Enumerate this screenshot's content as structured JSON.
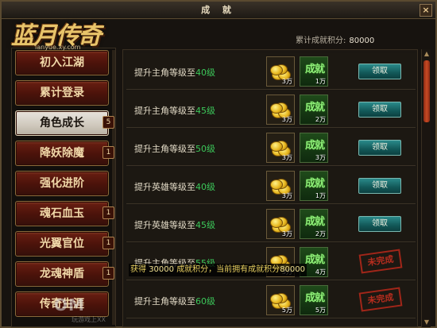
{
  "window": {
    "title": "成 就",
    "close_label": "×"
  },
  "logo": {
    "title": "蓝月传奇",
    "site": "lanyue.xy.com"
  },
  "header": {
    "total_label": "累计成就积分:",
    "total_value": "80000"
  },
  "sidebar": {
    "items": [
      {
        "label": "初入江湖",
        "badge": null,
        "active": false
      },
      {
        "label": "累计登录",
        "badge": null,
        "active": false
      },
      {
        "label": "角色成长",
        "badge": "5",
        "active": true
      },
      {
        "label": "降妖除魔",
        "badge": "1",
        "active": false
      },
      {
        "label": "强化进阶",
        "badge": null,
        "active": false
      },
      {
        "label": "魂石血玉",
        "badge": "1",
        "active": false
      },
      {
        "label": "光翼官位",
        "badge": "1",
        "active": false
      },
      {
        "label": "龙魂神盾",
        "badge": "1",
        "active": false
      },
      {
        "label": "传奇生涯",
        "badge": null,
        "active": false
      }
    ]
  },
  "achievements": [
    {
      "prefix": "提升主角等级至",
      "level": "40级",
      "gold": "3万",
      "points": "1万",
      "status": "claim"
    },
    {
      "prefix": "提升主角等级至",
      "level": "45级",
      "gold": "3万",
      "points": "2万",
      "status": "claim"
    },
    {
      "prefix": "提升主角等级至",
      "level": "50级",
      "gold": "3万",
      "points": "3万",
      "status": "claim"
    },
    {
      "prefix": "提升英雄等级至",
      "level": "40级",
      "gold": "3万",
      "points": "1万",
      "status": "claim"
    },
    {
      "prefix": "提升英雄等级至",
      "level": "45级",
      "gold": "3万",
      "points": "2万",
      "status": "claim"
    },
    {
      "prefix": "提升主角等级至",
      "level": "55级",
      "gold": "3万",
      "points": "4万",
      "status": "incomplete"
    },
    {
      "prefix": "提升主角等级至",
      "level": "60级",
      "gold": "5万",
      "points": "5万",
      "status": "incomplete"
    }
  ],
  "labels": {
    "claim": "领取",
    "incomplete": "未完成",
    "achievement_tile": "成就"
  },
  "toast": {
    "prefix": "获得",
    "gained": "30000",
    "middle": "成就积分，当前拥有成就积分",
    "current": "80000"
  },
  "watermark": {
    "text": "OM",
    "sub": "玩游戏上XX"
  },
  "colors": {
    "level_green": "#3cc85a",
    "claim_button": "#125858",
    "stamp_red": "#c83020",
    "active_tab": "#cfc8bc"
  }
}
